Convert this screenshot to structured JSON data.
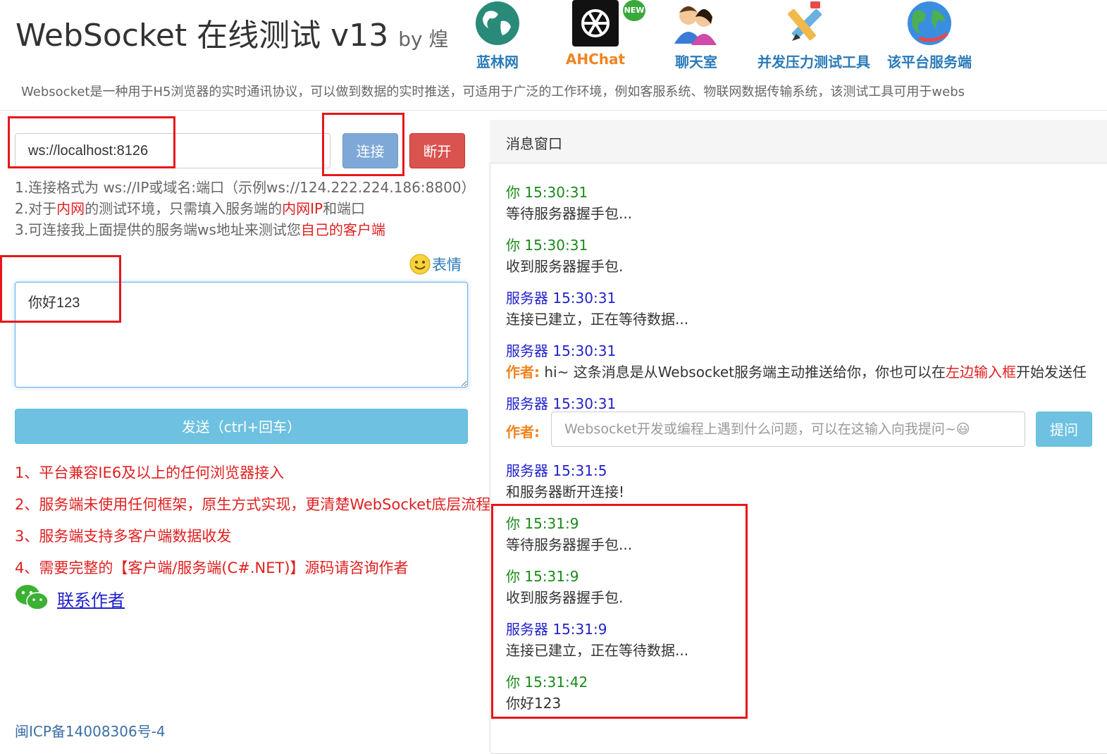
{
  "header": {
    "title": "WebSocket 在线测试 v13",
    "by": "by 煌",
    "nav": [
      {
        "label": "蓝林网",
        "icon": "globe-icon"
      },
      {
        "label": "AHChat",
        "icon": "openai-icon",
        "badge": "NEW"
      },
      {
        "label": "聊天室",
        "icon": "users-icon"
      },
      {
        "label": "并发压力测试工具",
        "icon": "tools-icon"
      },
      {
        "label": "该平台服务端",
        "icon": "earth-icon"
      }
    ],
    "description": "Websocket是一种用于H5浏览器的实时通讯协议，可以做到数据的实时推送，可适用于广泛的工作环境，例如客服系统、物联网数据传输系统，该测试工具可用于webs"
  },
  "connection": {
    "url_value": "ws://localhost:8126",
    "connect_label": "连接",
    "disconnect_label": "断开"
  },
  "hints": {
    "line1": "1.连接格式为 ws://IP或域名:端口（示例ws://124.222.224.186:8800）",
    "line2_a": "2.对于",
    "line2_b": "内网",
    "line2_c": "的测试环境，只需填入服务端的",
    "line2_d": "内网IP",
    "line2_e": "和端口",
    "line3_a": "3.可连接我上面提供的服务端ws地址来测试您",
    "line3_b": "自己的客户端"
  },
  "compose": {
    "emoji_label": "表情",
    "message_value": "你好123",
    "send_label": "发送（ctrl+回车）"
  },
  "features": [
    "1、平台兼容IE6及以上的任何浏览器接入",
    "2、服务端未使用任何框架，原生方式实现，更清楚WebSocket底层流程",
    "3、服务端支持多客户端数据收发",
    "4、需要完整的【客户端/服务端(C#.NET)】源码请咨询作者"
  ],
  "contact_label": "联系作者",
  "icp": "闽ICP备14008306号-4",
  "panel": {
    "title": "消息窗口",
    "messages": [
      {
        "head": "你 15:30:31",
        "body": "等待服务器握手包..."
      },
      {
        "head": "你 15:30:31",
        "body": "收到服务器握手包."
      },
      {
        "head": "服务器 15:30:31",
        "body": "连接已建立，正在等待数据..."
      },
      {
        "head": "服务器 15:30:31",
        "author": "作者:",
        "body_a": " hi~ 这条消息是从Websocket服务端主动推送给你，你也可以在",
        "body_b": "左边输入框",
        "body_c": "开始发送任"
      },
      {
        "head": "服务器 15:30:31",
        "author": "作者:",
        "ask_placeholder": "Websocket开发或编程上遇到什么问题，可以在这输入向我提问~😃",
        "ask_label": "提问"
      },
      {
        "head": "服务器 15:31:5",
        "body": "和服务器断开连接!"
      },
      {
        "head": "你 15:31:9",
        "body": "等待服务器握手包..."
      },
      {
        "head": "你 15:31:9",
        "body": "收到服务器握手包."
      },
      {
        "head": "服务器 15:31:9",
        "body": "连接已建立，正在等待数据..."
      },
      {
        "head": "你 15:31:42",
        "body": "你好123"
      }
    ]
  },
  "colors": {
    "connect": "#7ea8d6",
    "disconnect": "#d9534f",
    "send": "#6ec1e0",
    "highlight": "#e8161a",
    "you": "#1a8a1a",
    "server": "#2222cc",
    "author": "#f0841e"
  }
}
